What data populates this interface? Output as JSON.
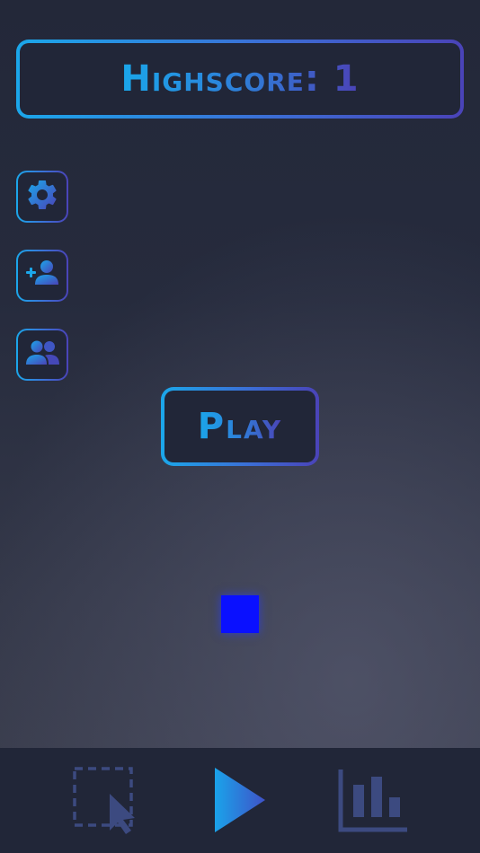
{
  "highscore": {
    "label": "Highscore:",
    "value": "1",
    "display": "Highscore: 1"
  },
  "side_buttons": [
    {
      "name": "settings",
      "icon": "gear-icon"
    },
    {
      "name": "add-friend",
      "icon": "add-person-icon"
    },
    {
      "name": "friends",
      "icon": "group-icon"
    }
  ],
  "play_button": {
    "label": "Play"
  },
  "bottom_bar": {
    "tabs": [
      {
        "name": "select",
        "icon": "selection-cursor-icon"
      },
      {
        "name": "play",
        "icon": "play-triangle-icon"
      },
      {
        "name": "stats",
        "icon": "bar-chart-icon"
      }
    ]
  },
  "colors": {
    "accent_start": "#1ba7ea",
    "accent_end": "#4a43b8",
    "player_square": "#0a10ff",
    "bar_icon": "#3c4a80"
  }
}
